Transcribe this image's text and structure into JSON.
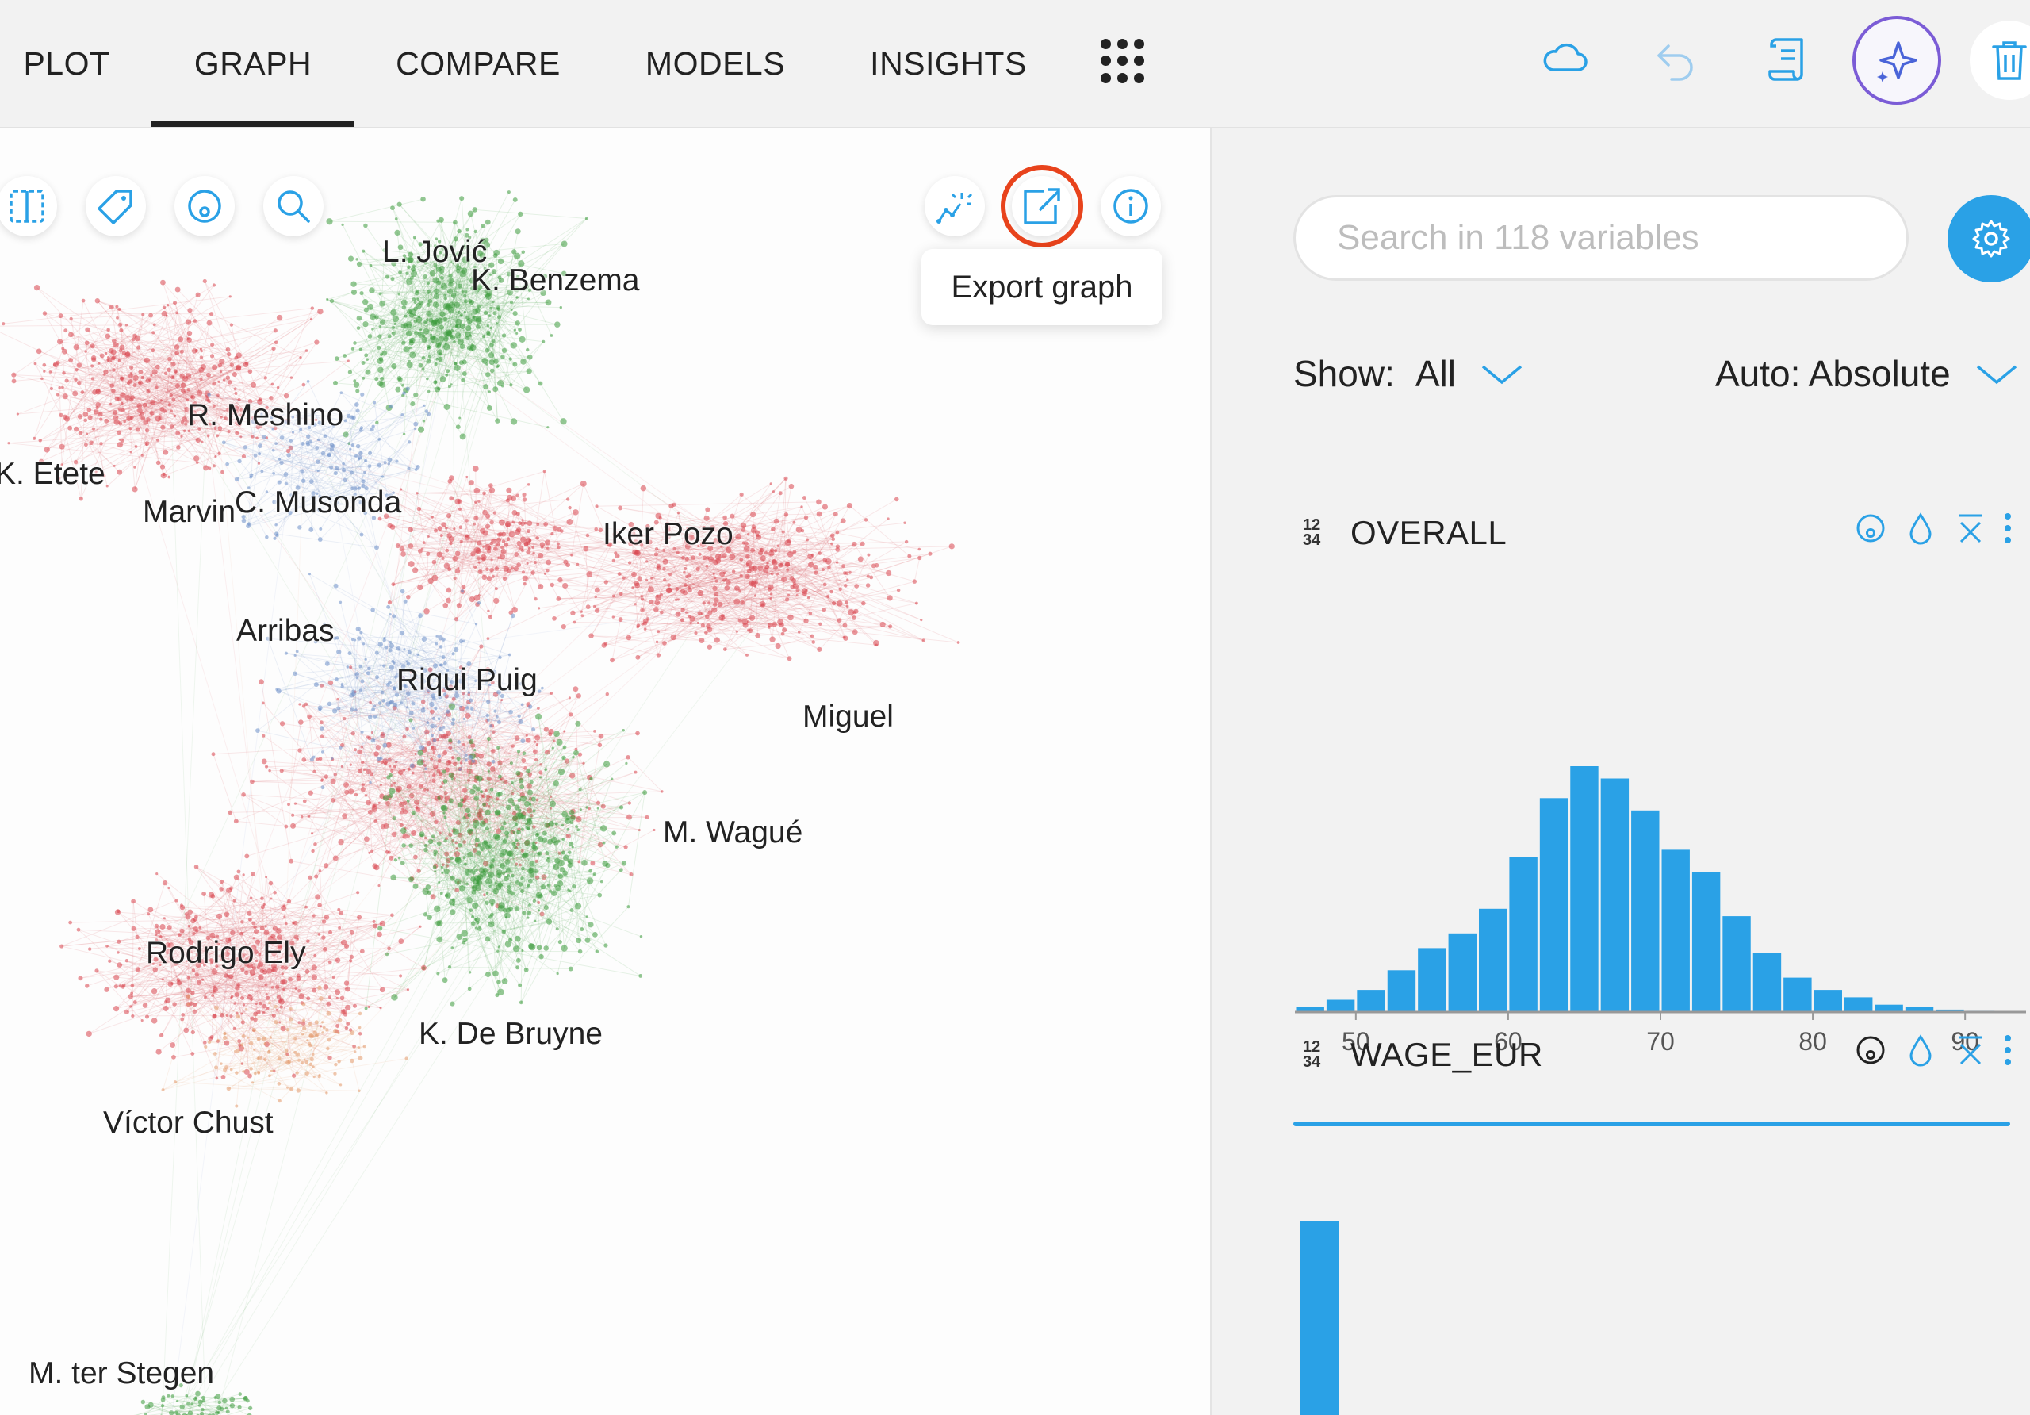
{
  "nav": {
    "tabs": [
      {
        "label": "PLOT",
        "active": false
      },
      {
        "label": "GRAPH",
        "active": true
      },
      {
        "label": "COMPARE",
        "active": false
      },
      {
        "label": "MODELS",
        "active": false
      },
      {
        "label": "INSIGHTS",
        "active": false
      }
    ],
    "apps_icon": "apps-grid-icon",
    "actions": [
      "cloud-icon",
      "undo-icon",
      "scroll-log-icon",
      "sparkle-assistant-icon",
      "trash-icon"
    ]
  },
  "graph": {
    "toolbar_left": [
      "split-view-icon",
      "tag-icon",
      "color-drop-icon",
      "search-icon"
    ],
    "toolbar_right": [
      "magic-wand-graph-icon",
      "export-icon",
      "info-icon"
    ],
    "tooltip": "Export graph",
    "node_labels": [
      "L. Jović",
      "K. Benzema",
      "R. Meshino",
      "K. Etete",
      "Marvin",
      "C. Musonda",
      "Iker Pozo",
      "Arribas",
      "Riqui Puig",
      "Miguel",
      "M. Wagué",
      "Rodrigo Ely",
      "K. De Bruyne",
      "Víctor Chust",
      "M. ter Stegen"
    ],
    "cluster_colors": {
      "green": "#3c9b3c",
      "red": "#d9464f",
      "blue": "#6d8fc9",
      "orange": "#e39a6d"
    }
  },
  "panel": {
    "search_placeholder": "Search in 118 variables",
    "show_label": "Show:",
    "show_value": "All",
    "auto_label": "Auto: Absolute",
    "accent_color": "#2aa1e6",
    "variables": [
      {
        "type_badge": [
          "12",
          "34"
        ],
        "name": "OVERALL",
        "icons": [
          "color-drop-icon",
          "water-drop-icon",
          "mean-x-bar-icon",
          "more-vertical-icon"
        ]
      },
      {
        "type_badge": [
          "12",
          "34"
        ],
        "name": "WAGE_EUR",
        "icons": [
          "color-drop-icon",
          "water-drop-icon",
          "mean-x-bar-icon",
          "more-vertical-icon"
        ]
      }
    ]
  },
  "chart_data": [
    {
      "type": "bar",
      "variable": "OVERALL",
      "bin_width": 2,
      "bins_start": [
        46,
        48,
        50,
        52,
        54,
        56,
        58,
        60,
        62,
        64,
        66,
        68,
        70,
        72,
        74,
        76,
        78,
        80,
        82,
        84,
        86,
        88,
        90
      ],
      "values": [
        2,
        5,
        9,
        17,
        26,
        32,
        42,
        63,
        87,
        100,
        95,
        82,
        66,
        57,
        39,
        24,
        14,
        9,
        6,
        3,
        2,
        1,
        0.5
      ],
      "values_unit": "relative frequency (max = 100)",
      "x_ticks": [
        "50",
        "60",
        "70",
        "80",
        "90"
      ],
      "xlim": [
        46,
        94
      ],
      "color": "#2aa1e6"
    },
    {
      "type": "bar",
      "variable": "WAGE_EUR",
      "visible_bars": "first bin only (chart cut off at bottom)",
      "color": "#2aa1e6"
    }
  ]
}
